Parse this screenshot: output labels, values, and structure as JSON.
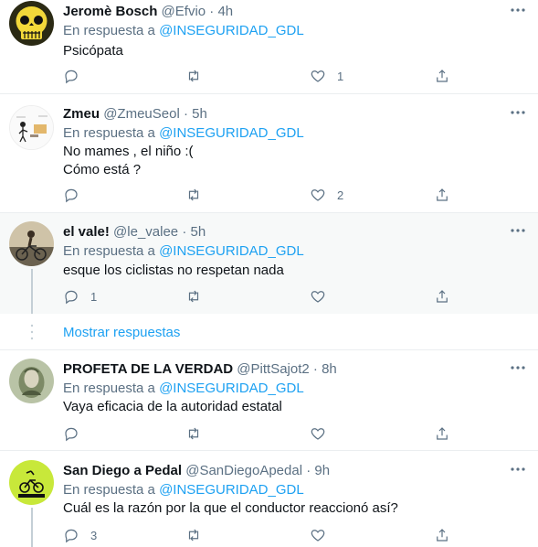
{
  "reply_prefix": "En respuesta a ",
  "colors": {
    "accent": "#1da1f2",
    "muted": "#5b7083",
    "text": "#0f1419",
    "divider": "#ebeef0"
  },
  "tweets": [
    {
      "name": "Jeromè Bosch",
      "handle": "@Efvio",
      "time": "4h",
      "mention": "@INSEGURIDAD_GDL",
      "text": "Psicópata",
      "replies": "",
      "likes": "1",
      "avatar_icon": "skull-avatar"
    },
    {
      "name": "Zmeu",
      "handle": "@ZmeuSeol",
      "time": "5h",
      "mention": "@INSEGURIDAD_GDL",
      "text": "No mames , el niño :(\nCómo está ?",
      "replies": "",
      "likes": "2",
      "avatar_icon": "sketch-avatar"
    },
    {
      "name": "el vale!",
      "handle": "@le_valee",
      "time": "5h",
      "mention": "@INSEGURIDAD_GDL",
      "text": "esque los ciclistas no respetan nada",
      "replies": "1",
      "likes": "",
      "avatar_icon": "cyclist-avatar"
    },
    {
      "name": "PROFETA DE LA VERDAD",
      "handle": "@PittSajot2",
      "time": "8h",
      "mention": "@INSEGURIDAD_GDL",
      "text": "Vaya eficacia de la autoridad estatal",
      "replies": "",
      "likes": "",
      "avatar_icon": "banknote-avatar"
    },
    {
      "name": "San Diego a Pedal",
      "handle": "@SanDiegoApedal",
      "time": "9h",
      "mention": "@INSEGURIDAD_GDL",
      "text": "Cuál es la razón por la que el conductor reaccionó así?",
      "replies": "3",
      "likes": "",
      "avatar_icon": "bike-logo-avatar"
    }
  ],
  "show_replies": "Mostrar respuestas",
  "separator": " · "
}
